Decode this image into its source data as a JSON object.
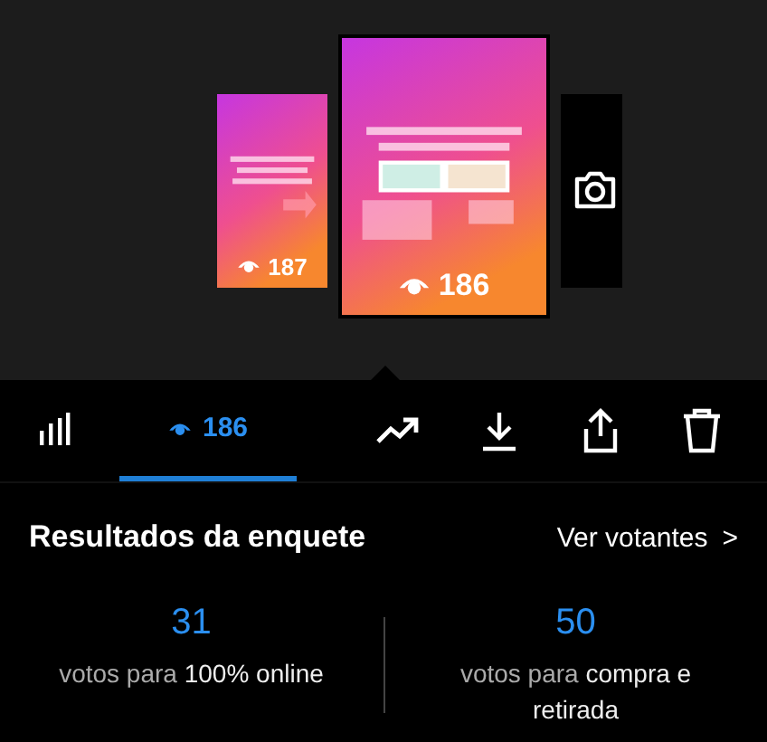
{
  "stories": [
    {
      "kind": "story",
      "views": "187",
      "selected": false
    },
    {
      "kind": "story",
      "views": "186",
      "selected": true
    },
    {
      "kind": "camera",
      "selected": false
    }
  ],
  "tabs": [
    {
      "kind": "insights",
      "selected": false
    },
    {
      "kind": "viewers",
      "label": "186",
      "selected": true
    }
  ],
  "actions": [
    {
      "kind": "promote"
    },
    {
      "kind": "download"
    },
    {
      "kind": "share"
    },
    {
      "kind": "delete"
    }
  ],
  "poll": {
    "title": "Resultados da enquete",
    "link": "Ver votantes",
    "link_icon": ">",
    "options": [
      {
        "count": "31",
        "text": "votos para **100% online**"
      },
      {
        "count": "50",
        "text": "votos para **compra e retirada**"
      }
    ]
  }
}
